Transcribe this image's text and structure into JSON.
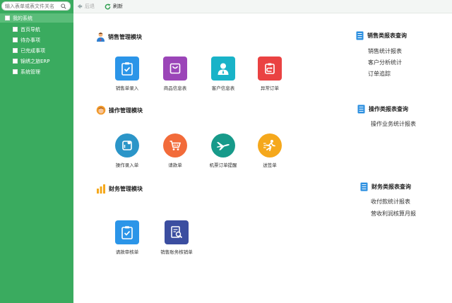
{
  "sidebar": {
    "search_placeholder": "输入表单或表文件关名",
    "root_label": "我的系统",
    "items": [
      {
        "label": "首页导航"
      },
      {
        "label": "待办事项"
      },
      {
        "label": "已完成事项"
      },
      {
        "label": "锦绣之旅ERP"
      },
      {
        "label": "系统管理"
      }
    ]
  },
  "toolbar": {
    "back_label": "后退",
    "refresh_label": "刷新"
  },
  "sales": {
    "title": "销售管理模块",
    "tiles": [
      {
        "label": "销售单录入",
        "color": "#2b95e8",
        "icon": "clipboard-check-icon"
      },
      {
        "label": "商品信息表",
        "color": "#9b45b8",
        "icon": "shopping-bag-icon"
      },
      {
        "label": "客户信息表",
        "color": "#19b3c8",
        "icon": "user-icon"
      },
      {
        "label": "异常订单",
        "color": "#ea4242",
        "icon": "return-icon"
      }
    ]
  },
  "operations": {
    "title": "操作管理模块",
    "tiles": [
      {
        "label": "操作录入单",
        "color": "#2b95c8",
        "icon": "form-entry-icon"
      },
      {
        "label": "请款单",
        "color": "#f26b3a",
        "icon": "cart-icon"
      },
      {
        "label": "机票订单提醒",
        "color": "#179a8a",
        "icon": "plane-icon"
      },
      {
        "label": "送签单",
        "color": "#f5a81c",
        "icon": "runner-icon"
      }
    ]
  },
  "finance": {
    "title": "财务管理模块",
    "tiles": [
      {
        "label": "请款审核单",
        "color": "#2b95e8",
        "icon": "clipboard-check-icon"
      },
      {
        "label": "销售账务核销单",
        "color": "#3b4ea0",
        "icon": "document-search-icon"
      }
    ]
  },
  "reports": {
    "sales": {
      "title": "销售类报表查询",
      "links": [
        "销售统计报表",
        "客户分析统计",
        "订单追踪"
      ]
    },
    "operations": {
      "title": "操作类报表查询",
      "links": [
        "操作业务统计报表"
      ]
    },
    "finance": {
      "title": "财务类报表查询",
      "links": [
        "收付款统计报表",
        "营收利润核算月报"
      ]
    }
  },
  "colors": {
    "sidebar": "#3aab5f",
    "report_icon": "#2b8fe0"
  }
}
